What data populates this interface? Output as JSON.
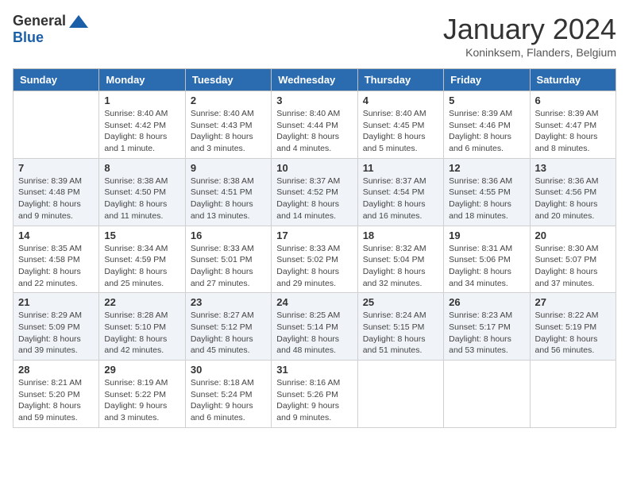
{
  "logo": {
    "general": "General",
    "blue": "Blue"
  },
  "title": "January 2024",
  "subtitle": "Koninksem, Flanders, Belgium",
  "headers": [
    "Sunday",
    "Monday",
    "Tuesday",
    "Wednesday",
    "Thursday",
    "Friday",
    "Saturday"
  ],
  "weeks": [
    [
      {
        "day": "",
        "sunrise": "",
        "sunset": "",
        "daylight": ""
      },
      {
        "day": "1",
        "sunrise": "Sunrise: 8:40 AM",
        "sunset": "Sunset: 4:42 PM",
        "daylight": "Daylight: 8 hours and 1 minute."
      },
      {
        "day": "2",
        "sunrise": "Sunrise: 8:40 AM",
        "sunset": "Sunset: 4:43 PM",
        "daylight": "Daylight: 8 hours and 3 minutes."
      },
      {
        "day": "3",
        "sunrise": "Sunrise: 8:40 AM",
        "sunset": "Sunset: 4:44 PM",
        "daylight": "Daylight: 8 hours and 4 minutes."
      },
      {
        "day": "4",
        "sunrise": "Sunrise: 8:40 AM",
        "sunset": "Sunset: 4:45 PM",
        "daylight": "Daylight: 8 hours and 5 minutes."
      },
      {
        "day": "5",
        "sunrise": "Sunrise: 8:39 AM",
        "sunset": "Sunset: 4:46 PM",
        "daylight": "Daylight: 8 hours and 6 minutes."
      },
      {
        "day": "6",
        "sunrise": "Sunrise: 8:39 AM",
        "sunset": "Sunset: 4:47 PM",
        "daylight": "Daylight: 8 hours and 8 minutes."
      }
    ],
    [
      {
        "day": "7",
        "sunrise": "Sunrise: 8:39 AM",
        "sunset": "Sunset: 4:48 PM",
        "daylight": "Daylight: 8 hours and 9 minutes."
      },
      {
        "day": "8",
        "sunrise": "Sunrise: 8:38 AM",
        "sunset": "Sunset: 4:50 PM",
        "daylight": "Daylight: 8 hours and 11 minutes."
      },
      {
        "day": "9",
        "sunrise": "Sunrise: 8:38 AM",
        "sunset": "Sunset: 4:51 PM",
        "daylight": "Daylight: 8 hours and 13 minutes."
      },
      {
        "day": "10",
        "sunrise": "Sunrise: 8:37 AM",
        "sunset": "Sunset: 4:52 PM",
        "daylight": "Daylight: 8 hours and 14 minutes."
      },
      {
        "day": "11",
        "sunrise": "Sunrise: 8:37 AM",
        "sunset": "Sunset: 4:54 PM",
        "daylight": "Daylight: 8 hours and 16 minutes."
      },
      {
        "day": "12",
        "sunrise": "Sunrise: 8:36 AM",
        "sunset": "Sunset: 4:55 PM",
        "daylight": "Daylight: 8 hours and 18 minutes."
      },
      {
        "day": "13",
        "sunrise": "Sunrise: 8:36 AM",
        "sunset": "Sunset: 4:56 PM",
        "daylight": "Daylight: 8 hours and 20 minutes."
      }
    ],
    [
      {
        "day": "14",
        "sunrise": "Sunrise: 8:35 AM",
        "sunset": "Sunset: 4:58 PM",
        "daylight": "Daylight: 8 hours and 22 minutes."
      },
      {
        "day": "15",
        "sunrise": "Sunrise: 8:34 AM",
        "sunset": "Sunset: 4:59 PM",
        "daylight": "Daylight: 8 hours and 25 minutes."
      },
      {
        "day": "16",
        "sunrise": "Sunrise: 8:33 AM",
        "sunset": "Sunset: 5:01 PM",
        "daylight": "Daylight: 8 hours and 27 minutes."
      },
      {
        "day": "17",
        "sunrise": "Sunrise: 8:33 AM",
        "sunset": "Sunset: 5:02 PM",
        "daylight": "Daylight: 8 hours and 29 minutes."
      },
      {
        "day": "18",
        "sunrise": "Sunrise: 8:32 AM",
        "sunset": "Sunset: 5:04 PM",
        "daylight": "Daylight: 8 hours and 32 minutes."
      },
      {
        "day": "19",
        "sunrise": "Sunrise: 8:31 AM",
        "sunset": "Sunset: 5:06 PM",
        "daylight": "Daylight: 8 hours and 34 minutes."
      },
      {
        "day": "20",
        "sunrise": "Sunrise: 8:30 AM",
        "sunset": "Sunset: 5:07 PM",
        "daylight": "Daylight: 8 hours and 37 minutes."
      }
    ],
    [
      {
        "day": "21",
        "sunrise": "Sunrise: 8:29 AM",
        "sunset": "Sunset: 5:09 PM",
        "daylight": "Daylight: 8 hours and 39 minutes."
      },
      {
        "day": "22",
        "sunrise": "Sunrise: 8:28 AM",
        "sunset": "Sunset: 5:10 PM",
        "daylight": "Daylight: 8 hours and 42 minutes."
      },
      {
        "day": "23",
        "sunrise": "Sunrise: 8:27 AM",
        "sunset": "Sunset: 5:12 PM",
        "daylight": "Daylight: 8 hours and 45 minutes."
      },
      {
        "day": "24",
        "sunrise": "Sunrise: 8:25 AM",
        "sunset": "Sunset: 5:14 PM",
        "daylight": "Daylight: 8 hours and 48 minutes."
      },
      {
        "day": "25",
        "sunrise": "Sunrise: 8:24 AM",
        "sunset": "Sunset: 5:15 PM",
        "daylight": "Daylight: 8 hours and 51 minutes."
      },
      {
        "day": "26",
        "sunrise": "Sunrise: 8:23 AM",
        "sunset": "Sunset: 5:17 PM",
        "daylight": "Daylight: 8 hours and 53 minutes."
      },
      {
        "day": "27",
        "sunrise": "Sunrise: 8:22 AM",
        "sunset": "Sunset: 5:19 PM",
        "daylight": "Daylight: 8 hours and 56 minutes."
      }
    ],
    [
      {
        "day": "28",
        "sunrise": "Sunrise: 8:21 AM",
        "sunset": "Sunset: 5:20 PM",
        "daylight": "Daylight: 8 hours and 59 minutes."
      },
      {
        "day": "29",
        "sunrise": "Sunrise: 8:19 AM",
        "sunset": "Sunset: 5:22 PM",
        "daylight": "Daylight: 9 hours and 3 minutes."
      },
      {
        "day": "30",
        "sunrise": "Sunrise: 8:18 AM",
        "sunset": "Sunset: 5:24 PM",
        "daylight": "Daylight: 9 hours and 6 minutes."
      },
      {
        "day": "31",
        "sunrise": "Sunrise: 8:16 AM",
        "sunset": "Sunset: 5:26 PM",
        "daylight": "Daylight: 9 hours and 9 minutes."
      },
      {
        "day": "",
        "sunrise": "",
        "sunset": "",
        "daylight": ""
      },
      {
        "day": "",
        "sunrise": "",
        "sunset": "",
        "daylight": ""
      },
      {
        "day": "",
        "sunrise": "",
        "sunset": "",
        "daylight": ""
      }
    ]
  ]
}
